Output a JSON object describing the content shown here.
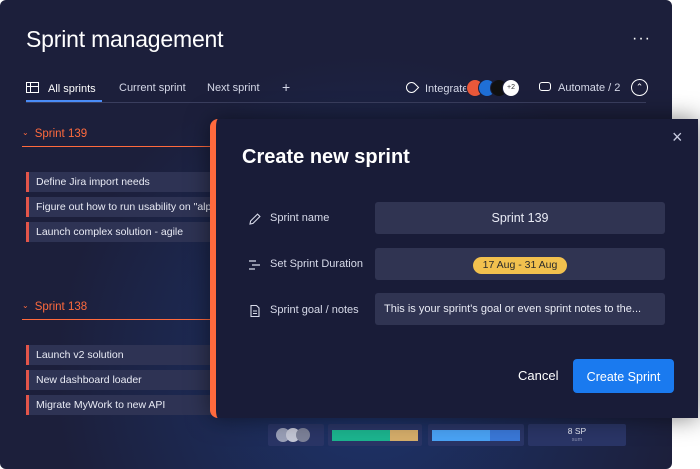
{
  "page": {
    "title": "Sprint management",
    "more_label": "···"
  },
  "tabs": {
    "all_sprints": "All sprints",
    "current_sprint": "Current sprint",
    "next_sprint": "Next sprint",
    "add": "+",
    "integrate": "Integrate",
    "integrate_extra": "+2",
    "automate": "Automate / 2"
  },
  "groups": [
    {
      "title": "Sprint 139",
      "color": "#ff6a3d",
      "items": [
        "Define Jira import needs",
        "Figure out how to run usability on \"alpha\"",
        "Launch complex solution - agile"
      ]
    },
    {
      "title": "Sprint 138",
      "color": "#ff6a3d",
      "items": [
        "Launch v2 solution",
        "New dashboard loader",
        "Migrate MyWork to new API"
      ]
    }
  ],
  "summary_strip": {
    "sp_value": "8 SP",
    "sp_caption": "sum"
  },
  "modal": {
    "title": "Create new sprint",
    "fields": {
      "name_label": "Sprint name",
      "name_value": "Sprint 139",
      "duration_label": "Set Sprint Duration",
      "duration_value": "17 Aug - 31 Aug",
      "goal_label": "Sprint goal / notes",
      "goal_value": "This is your sprint's goal or even sprint notes to the..."
    },
    "cancel_label": "Cancel",
    "create_label": "Create Sprint",
    "close_label": "×"
  },
  "colors": {
    "accent_orange": "#ff6a3d",
    "primary_blue": "#1a7aef",
    "date_pill": "#f2c14e",
    "board_bg": "#1c1f3b"
  }
}
